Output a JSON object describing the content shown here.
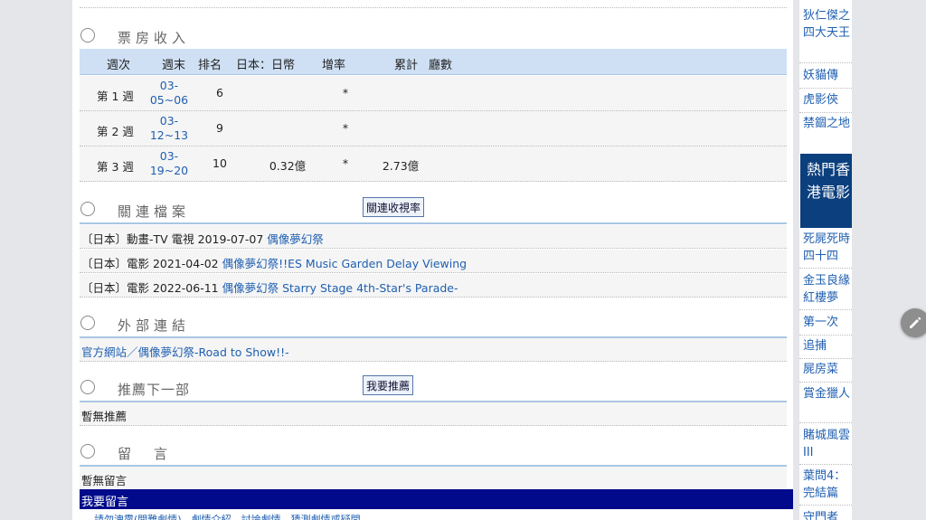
{
  "sections": {
    "box_office": "票房收入",
    "related": "關連檔案",
    "related_button": "關連收視率",
    "external": "外部連結",
    "recommend": "推薦下一部",
    "recommend_button": "我要推薦",
    "comments": "留　言"
  },
  "box_office": {
    "headers": [
      "週次",
      "週末",
      "排名",
      "日本：日幣",
      "增率",
      "累計",
      "廳數"
    ],
    "rows": [
      {
        "week": "第 1 週",
        "date1": "03-",
        "date2": "05~06",
        "rank": "6",
        "daily": "",
        "growth": "*",
        "cumulative": ""
      },
      {
        "week": "第 2 週",
        "date1": "03-",
        "date2": "12~13",
        "rank": "9",
        "daily": "",
        "growth": "*",
        "cumulative": ""
      },
      {
        "week": "第 3 週",
        "date1": "03-",
        "date2": "19~20",
        "rank": "10",
        "daily": "0.32億",
        "growth": "*",
        "cumulative": "2.73億"
      }
    ]
  },
  "related_files": [
    {
      "prefix": "〔日本〕動畫-TV 電視 2019-07-07 ",
      "link": "偶像夢幻祭"
    },
    {
      "prefix": "〔日本〕電影 2021-04-02 ",
      "link": "偶像夢幻祭!!ES Music Garden Delay Viewing"
    },
    {
      "prefix": "〔日本〕電影 2022-06-11 ",
      "link": "偶像夢幻祭 Starry Stage 4th-Star's Parade-"
    }
  ],
  "external_link": "官方網站／偶像夢幻祭-Road to Show!!-",
  "no_recommend": "暫無推薦",
  "no_comments": "暫無留言",
  "comment_bar": "我要留言",
  "cut_text": "請勿洩露(開難劇情)、劇情介紹、討論劇情、猜測劇情或疑問。",
  "sidebar": {
    "items_top": [
      {
        "label": "狄仁傑之四大天王"
      },
      {
        "label": "妖貓傳"
      },
      {
        "label": "虎影俠"
      },
      {
        "label": "禁錮之地"
      }
    ],
    "active": "熱門香港電影",
    "items_bottom": [
      {
        "label": "死屍死時四十四"
      },
      {
        "label": "金玉良緣紅樓夢"
      },
      {
        "label": "第一次"
      },
      {
        "label": "追捕"
      },
      {
        "label": "屍房菜"
      },
      {
        "label": "賞金獵人"
      },
      {
        "label": "賭城風雲III"
      },
      {
        "label": "葉問4：完結篇"
      },
      {
        "label": "守門者"
      }
    ]
  },
  "colors": {
    "header_blue": "#cfe0f4",
    "comment_bar": "#000a8a",
    "sidebar_active": "#0b3f7e",
    "link": "#1f5fb0"
  }
}
